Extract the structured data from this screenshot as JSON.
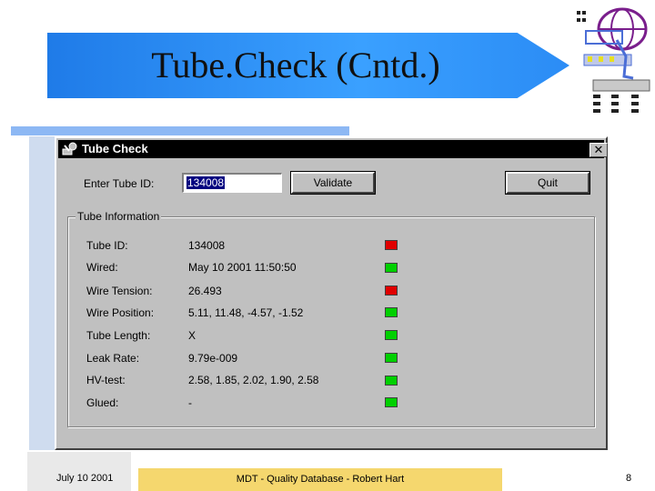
{
  "slide": {
    "title": "Tube.Check (Cntd.)",
    "footer_date": "July 10 2001",
    "footer_center": "MDT - Quality Database - Robert Hart",
    "page_number": "8"
  },
  "dialog": {
    "title": "Tube Check",
    "close_glyph": "✕",
    "enter_label": "Enter Tube ID:",
    "tube_id_value": "134008",
    "validate_label": "Validate",
    "quit_label": "Quit",
    "group_title": "Tube Information",
    "rows": [
      {
        "label": "Tube ID:",
        "value": "134008",
        "status": "red"
      },
      {
        "label": "Wired:",
        "value": "May 10 2001 11:50:50",
        "status": "green"
      },
      {
        "label": "Wire Tension:",
        "value": "26.493",
        "status": "red"
      },
      {
        "label": "Wire Position:",
        "value": "5.11, 11.48, -4.57, -1.52",
        "status": "green"
      },
      {
        "label": "Tube Length:",
        "value": "X",
        "status": "green"
      },
      {
        "label": "Leak Rate:",
        "value": "9.79e-009",
        "status": "green"
      },
      {
        "label": "HV-test:",
        "value": "2.58, 1.85, 2.02, 1.90, 2.58",
        "status": "green"
      },
      {
        "label": "Glued:",
        "value": "-",
        "status": "green"
      }
    ]
  },
  "colors": {
    "status_red": "#e00000",
    "status_green": "#00d000",
    "title_banner": "#2b8cf5",
    "footer_band": "#f5d76e"
  },
  "icons": {
    "logo": "atlas-logo-icon",
    "app": "app-icon"
  }
}
